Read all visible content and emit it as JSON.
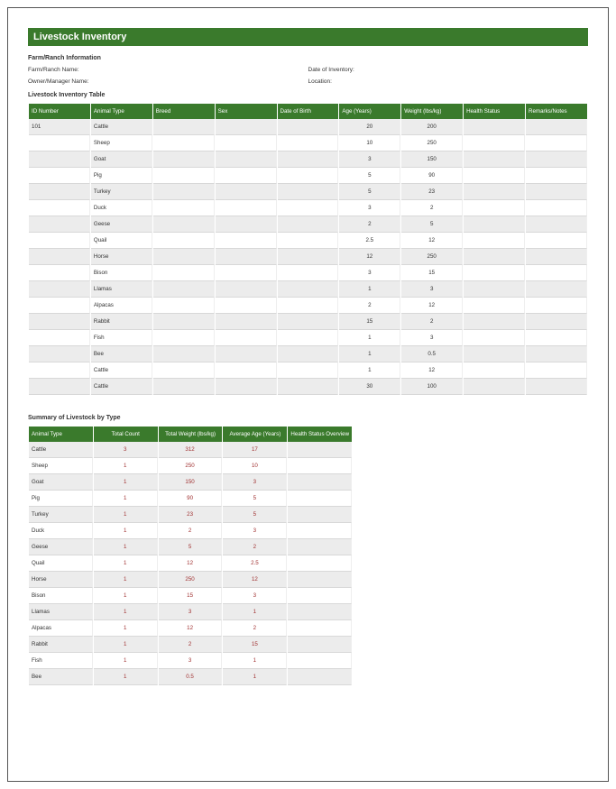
{
  "title": "Livestock Inventory",
  "farm_info": {
    "heading": "Farm/Ranch Information",
    "name_label": "Farm/Ranch Name:",
    "date_label": "Date of Inventory:",
    "owner_label": "Owner/Manager Name:",
    "location_label": "Location:"
  },
  "inventory_table": {
    "heading": "Livestock Inventory Table",
    "headers": [
      "ID Number",
      "Animal Type",
      "Breed",
      "Sex",
      "Date of Birth",
      "Age (Years)",
      "Weight (lbs/kg)",
      "Health Status",
      "Remarks/Notes"
    ],
    "rows": [
      {
        "id": "101",
        "type": "Cattle",
        "breed": "",
        "sex": "",
        "dob": "",
        "age": "20",
        "weight": "200",
        "health": "",
        "remarks": ""
      },
      {
        "id": "",
        "type": "Sheep",
        "breed": "",
        "sex": "",
        "dob": "",
        "age": "10",
        "weight": "250",
        "health": "",
        "remarks": ""
      },
      {
        "id": "",
        "type": "Goat",
        "breed": "",
        "sex": "",
        "dob": "",
        "age": "3",
        "weight": "150",
        "health": "",
        "remarks": ""
      },
      {
        "id": "",
        "type": "Pig",
        "breed": "",
        "sex": "",
        "dob": "",
        "age": "5",
        "weight": "90",
        "health": "",
        "remarks": ""
      },
      {
        "id": "",
        "type": "Turkey",
        "breed": "",
        "sex": "",
        "dob": "",
        "age": "5",
        "weight": "23",
        "health": "",
        "remarks": ""
      },
      {
        "id": "",
        "type": "Duck",
        "breed": "",
        "sex": "",
        "dob": "",
        "age": "3",
        "weight": "2",
        "health": "",
        "remarks": ""
      },
      {
        "id": "",
        "type": "Geese",
        "breed": "",
        "sex": "",
        "dob": "",
        "age": "2",
        "weight": "5",
        "health": "",
        "remarks": ""
      },
      {
        "id": "",
        "type": "Quail",
        "breed": "",
        "sex": "",
        "dob": "",
        "age": "2.5",
        "weight": "12",
        "health": "",
        "remarks": ""
      },
      {
        "id": "",
        "type": "Horse",
        "breed": "",
        "sex": "",
        "dob": "",
        "age": "12",
        "weight": "250",
        "health": "",
        "remarks": ""
      },
      {
        "id": "",
        "type": "Bison",
        "breed": "",
        "sex": "",
        "dob": "",
        "age": "3",
        "weight": "15",
        "health": "",
        "remarks": ""
      },
      {
        "id": "",
        "type": "Llamas",
        "breed": "",
        "sex": "",
        "dob": "",
        "age": "1",
        "weight": "3",
        "health": "",
        "remarks": ""
      },
      {
        "id": "",
        "type": "Alpacas",
        "breed": "",
        "sex": "",
        "dob": "",
        "age": "2",
        "weight": "12",
        "health": "",
        "remarks": ""
      },
      {
        "id": "",
        "type": "Rabbit",
        "breed": "",
        "sex": "",
        "dob": "",
        "age": "15",
        "weight": "2",
        "health": "",
        "remarks": ""
      },
      {
        "id": "",
        "type": "Fish",
        "breed": "",
        "sex": "",
        "dob": "",
        "age": "1",
        "weight": "3",
        "health": "",
        "remarks": ""
      },
      {
        "id": "",
        "type": "Bee",
        "breed": "",
        "sex": "",
        "dob": "",
        "age": "1",
        "weight": "0.5",
        "health": "",
        "remarks": ""
      },
      {
        "id": "",
        "type": "Cattle",
        "breed": "",
        "sex": "",
        "dob": "",
        "age": "1",
        "weight": "12",
        "health": "",
        "remarks": ""
      },
      {
        "id": "",
        "type": "Cattle",
        "breed": "",
        "sex": "",
        "dob": "",
        "age": "30",
        "weight": "100",
        "health": "",
        "remarks": ""
      }
    ]
  },
  "summary_table": {
    "heading": "Summary of Livestock by Type",
    "headers": [
      "Animal Type",
      "Total Count",
      "Total Weight (lbs/kg)",
      "Average Age (Years)",
      "Health Status Overview"
    ],
    "rows": [
      {
        "type": "Cattle",
        "count": "3",
        "weight": "312",
        "age": "17",
        "health": ""
      },
      {
        "type": "Sheep",
        "count": "1",
        "weight": "250",
        "age": "10",
        "health": ""
      },
      {
        "type": "Goat",
        "count": "1",
        "weight": "150",
        "age": "3",
        "health": ""
      },
      {
        "type": "Pig",
        "count": "1",
        "weight": "90",
        "age": "5",
        "health": ""
      },
      {
        "type": "Turkey",
        "count": "1",
        "weight": "23",
        "age": "5",
        "health": ""
      },
      {
        "type": "Duck",
        "count": "1",
        "weight": "2",
        "age": "3",
        "health": ""
      },
      {
        "type": "Geese",
        "count": "1",
        "weight": "5",
        "age": "2",
        "health": ""
      },
      {
        "type": "Quail",
        "count": "1",
        "weight": "12",
        "age": "2.5",
        "health": ""
      },
      {
        "type": "Horse",
        "count": "1",
        "weight": "250",
        "age": "12",
        "health": ""
      },
      {
        "type": "Bison",
        "count": "1",
        "weight": "15",
        "age": "3",
        "health": ""
      },
      {
        "type": "Llamas",
        "count": "1",
        "weight": "3",
        "age": "1",
        "health": ""
      },
      {
        "type": "Alpacas",
        "count": "1",
        "weight": "12",
        "age": "2",
        "health": ""
      },
      {
        "type": "Rabbit",
        "count": "1",
        "weight": "2",
        "age": "15",
        "health": ""
      },
      {
        "type": "Fish",
        "count": "1",
        "weight": "3",
        "age": "1",
        "health": ""
      },
      {
        "type": "Bee",
        "count": "1",
        "weight": "0.5",
        "age": "1",
        "health": ""
      }
    ]
  }
}
